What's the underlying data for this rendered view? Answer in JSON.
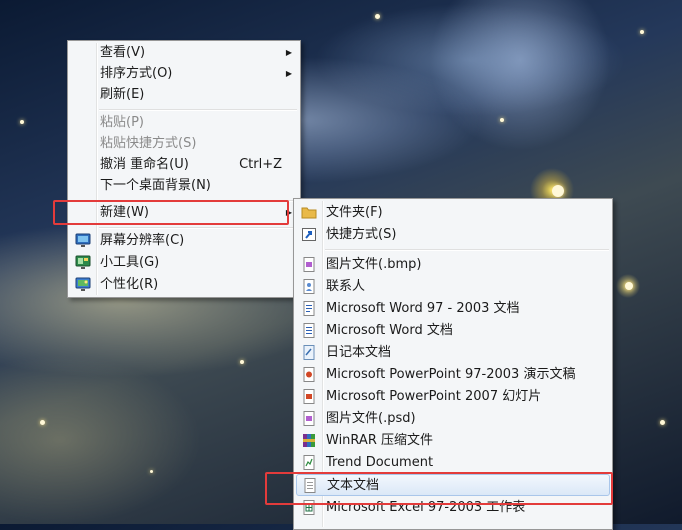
{
  "context_menu": {
    "items": [
      {
        "label": "查看(V)",
        "submenu": true
      },
      {
        "label": "排序方式(O)",
        "submenu": true
      },
      {
        "label": "刷新(E)"
      },
      {
        "label": "粘贴(P)",
        "disabled": true
      },
      {
        "label": "粘贴快捷方式(S)",
        "disabled": true
      },
      {
        "label": "撤消 重命名(U)",
        "shortcut": "Ctrl+Z"
      },
      {
        "label": "下一个桌面背景(N)"
      },
      {
        "label": "新建(W)",
        "submenu": true,
        "highlighted": true
      },
      {
        "label": "屏幕分辨率(C)",
        "icon": "display-icon"
      },
      {
        "label": "小工具(G)",
        "icon": "gadgets-icon"
      },
      {
        "label": "个性化(R)",
        "icon": "personalize-icon"
      }
    ]
  },
  "new_submenu": {
    "items": [
      {
        "label": "文件夹(F)",
        "icon": "folder-icon"
      },
      {
        "label": "快捷方式(S)",
        "icon": "shortcut-icon"
      },
      {
        "label": "图片文件(.bmp)",
        "icon": "bmp-file-icon"
      },
      {
        "label": "联系人",
        "icon": "contact-icon"
      },
      {
        "label": "Microsoft Word 97 - 2003 文档",
        "icon": "word-doc-icon"
      },
      {
        "label": "Microsoft Word 文档",
        "icon": "word-docx-icon"
      },
      {
        "label": "日记本文档",
        "icon": "journal-icon"
      },
      {
        "label": "Microsoft PowerPoint 97-2003 演示文稿",
        "icon": "ppt-icon"
      },
      {
        "label": "Microsoft PowerPoint 2007 幻灯片",
        "icon": "pptx-icon"
      },
      {
        "label": "图片文件(.psd)",
        "icon": "psd-file-icon"
      },
      {
        "label": "WinRAR 压缩文件",
        "icon": "winrar-icon"
      },
      {
        "label": "Trend Document",
        "icon": "trend-doc-icon"
      },
      {
        "label": "文本文档",
        "icon": "text-doc-icon",
        "highlighted": true
      },
      {
        "label": "Microsoft Excel 97-2003 工作表",
        "icon": "excel-icon"
      }
    ]
  },
  "colors": {
    "highlight_border": "#e33b3b",
    "menu_bg": "#f4f6f8"
  }
}
